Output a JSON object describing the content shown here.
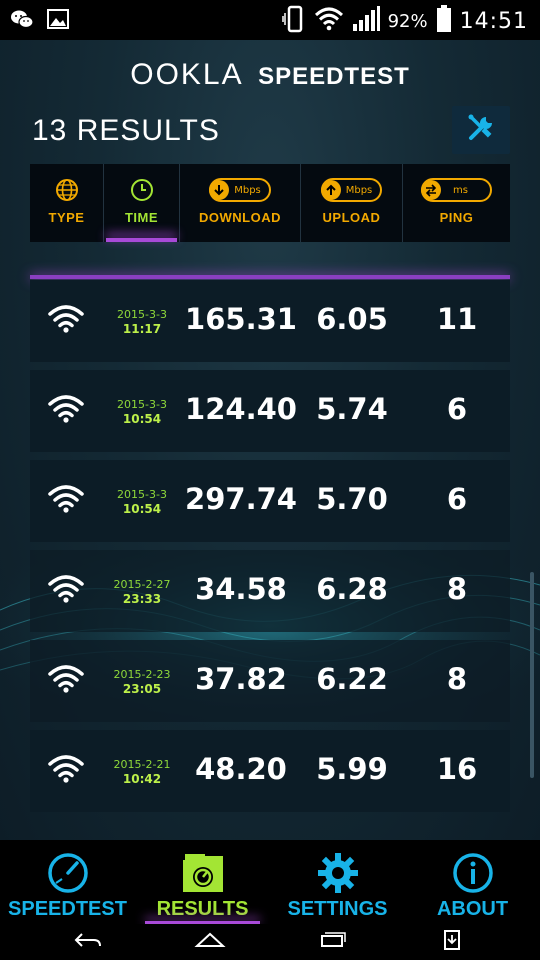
{
  "status_bar": {
    "left_icons": [
      "wechat-icon",
      "gallery-icon"
    ],
    "right_icons": [
      "vibrate-icon",
      "wifi-icon",
      "signal-icon",
      "battery-icon"
    ],
    "battery": "92%",
    "time": "14:51"
  },
  "header": {
    "brand_ookla": "OOKLA",
    "brand_speedtest": "SPEEDTEST",
    "results_title": "13 RESULTS",
    "tools_icon": "tools-icon"
  },
  "columns": [
    {
      "label": "TYPE",
      "icon": "globe-icon",
      "active": false
    },
    {
      "label": "TIME",
      "icon": "clock-icon",
      "active": true
    },
    {
      "label": "DOWNLOAD",
      "icon": "download-arrow-icon",
      "unit": "Mbps",
      "active": false
    },
    {
      "label": "UPLOAD",
      "icon": "upload-arrow-icon",
      "unit": "Mbps",
      "active": false
    },
    {
      "label": "PING",
      "icon": "ping-arrows-icon",
      "unit": "ms",
      "active": false
    }
  ],
  "results": [
    {
      "type": "wifi",
      "date": "2015-3-3",
      "time": "11:17",
      "download": "165.31",
      "upload": "6.05",
      "ping": "11"
    },
    {
      "type": "wifi",
      "date": "2015-3-3",
      "time": "10:54",
      "download": "124.40",
      "upload": "5.74",
      "ping": "6"
    },
    {
      "type": "wifi",
      "date": "2015-3-3",
      "time": "10:54",
      "download": "297.74",
      "upload": "5.70",
      "ping": "6"
    },
    {
      "type": "wifi",
      "date": "2015-2-27",
      "time": "23:33",
      "download": "34.58",
      "upload": "6.28",
      "ping": "8"
    },
    {
      "type": "wifi",
      "date": "2015-2-23",
      "time": "23:05",
      "download": "37.82",
      "upload": "6.22",
      "ping": "8"
    },
    {
      "type": "wifi",
      "date": "2015-2-21",
      "time": "10:42",
      "download": "48.20",
      "upload": "5.99",
      "ping": "16"
    }
  ],
  "bottom_nav": [
    {
      "label": "SPEEDTEST",
      "icon": "speedometer-icon",
      "active": false
    },
    {
      "label": "RESULTS",
      "icon": "results-folder-icon",
      "active": true
    },
    {
      "label": "SETTINGS",
      "icon": "gear-icon",
      "active": false
    },
    {
      "label": "ABOUT",
      "icon": "info-icon",
      "active": false
    }
  ],
  "system_nav": [
    "back-icon",
    "home-icon",
    "recents-icon",
    "screenshot-icon"
  ],
  "colors": {
    "accent_orange": "#f2a900",
    "accent_green": "#a3e534",
    "accent_blue": "#18b3e8",
    "accent_purple": "#a84ad8"
  }
}
